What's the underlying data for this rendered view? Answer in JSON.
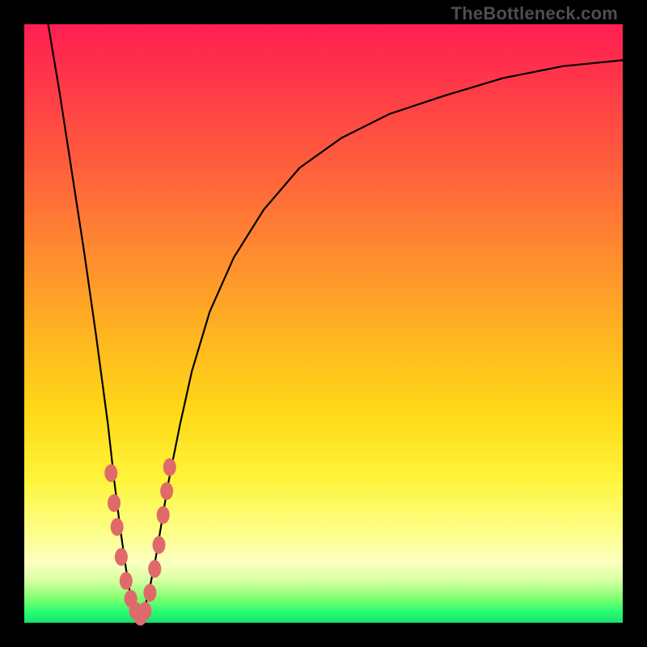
{
  "watermark": "TheBottleneck.com",
  "colors": {
    "frame": "#000000",
    "curve": "#000000",
    "marker": "#e06a6a",
    "gradient_stops": [
      "#ff1f53",
      "#ff334a",
      "#ff5a3e",
      "#ff8a2f",
      "#ffb521",
      "#ffd918",
      "#fff43a",
      "#fdff8a",
      "#fbffc0",
      "#d6ffa1",
      "#7eff6e",
      "#2fff71",
      "#14e26d"
    ]
  },
  "chart_data": {
    "type": "line",
    "title": "",
    "xlabel": "",
    "ylabel": "",
    "xlim": [
      0,
      100
    ],
    "ylim": [
      0,
      100
    ],
    "grid": false,
    "legend": false,
    "note": "V-shaped bottleneck curve: y ≈ 100·|x - x0|/x0 on the left branch, and a concave-rising asymptote on the right branch. Minimum (y≈0) around x≈19. Axis numbers are not shown in the image; x and y are normalized 0–100 estimates read from pixel positions.",
    "series": [
      {
        "name": "bottleneck-curve",
        "x": [
          4,
          6,
          8,
          10,
          12,
          14,
          15,
          16,
          17,
          18,
          19,
          20,
          21,
          22,
          23,
          24,
          26,
          28,
          31,
          35,
          40,
          46,
          53,
          61,
          70,
          80,
          90,
          100
        ],
        "y": [
          100,
          88,
          75,
          62,
          48,
          33,
          24,
          16,
          9,
          3,
          0,
          2,
          6,
          11,
          17,
          23,
          33,
          42,
          52,
          61,
          69,
          76,
          81,
          85,
          88,
          91,
          93,
          94
        ]
      }
    ],
    "markers": {
      "name": "highlight-points",
      "note": "salmon dots clustered near the curve's valley, on both arms just above the green band",
      "points": [
        {
          "x": 14.5,
          "y": 25
        },
        {
          "x": 15.0,
          "y": 20
        },
        {
          "x": 15.5,
          "y": 16
        },
        {
          "x": 16.2,
          "y": 11
        },
        {
          "x": 17.0,
          "y": 7
        },
        {
          "x": 17.8,
          "y": 4
        },
        {
          "x": 18.6,
          "y": 2
        },
        {
          "x": 19.4,
          "y": 1
        },
        {
          "x": 20.2,
          "y": 2
        },
        {
          "x": 21.0,
          "y": 5
        },
        {
          "x": 21.8,
          "y": 9
        },
        {
          "x": 22.5,
          "y": 13
        },
        {
          "x": 23.2,
          "y": 18
        },
        {
          "x": 23.8,
          "y": 22
        },
        {
          "x": 24.3,
          "y": 26
        }
      ]
    }
  }
}
